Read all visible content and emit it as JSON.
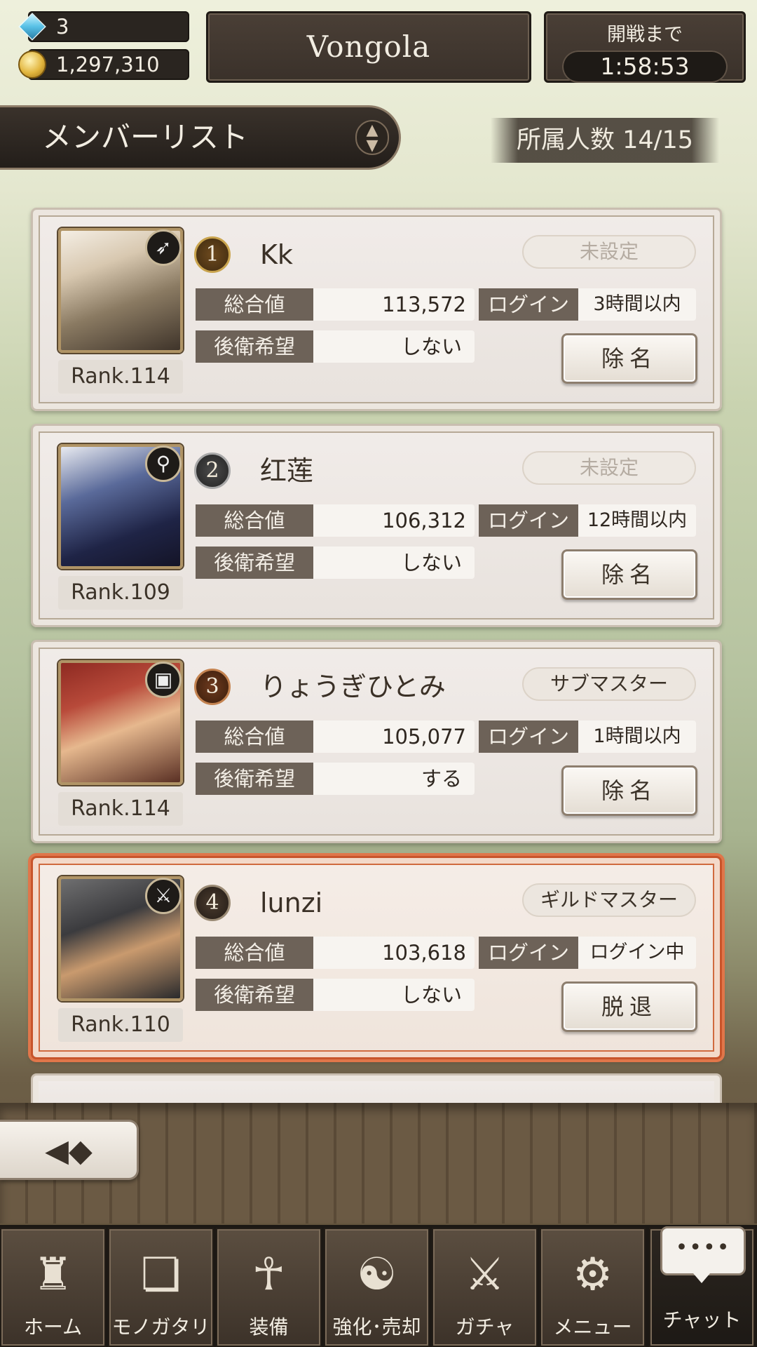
{
  "currency": {
    "gems": "3",
    "coins": "1,297,310"
  },
  "guild": {
    "name": "Vongola"
  },
  "battle_timer": {
    "label": "開戦まで",
    "value": "1:58:53"
  },
  "section": {
    "title": "メンバーリスト",
    "member_count": "所属人数 14/15"
  },
  "stat_labels": {
    "total": "総合値",
    "login": "ログイン",
    "rear_guard": "後衛希望"
  },
  "members": [
    {
      "position": "1",
      "name": "Kk",
      "rank": "Rank.114",
      "role": "未設定",
      "total": "113,572",
      "login": "3時間以内",
      "rear_guard": "しない",
      "action": "除名",
      "class_icon": "bow-icon"
    },
    {
      "position": "2",
      "name": "红莲",
      "rank": "Rank.109",
      "role": "未設定",
      "total": "106,312",
      "login": "12時間以内",
      "rear_guard": "しない",
      "action": "除名",
      "class_icon": "staff-icon"
    },
    {
      "position": "3",
      "name": "りょうぎひとみ",
      "rank": "Rank.114",
      "role": "サブマスター",
      "total": "105,077",
      "login": "1時間以内",
      "rear_guard": "する",
      "action": "除名",
      "class_icon": "tome-icon"
    },
    {
      "position": "4",
      "name": "lunzi",
      "rank": "Rank.110",
      "role": "ギルドマスター",
      "total": "103,618",
      "login": "ログイン中",
      "rear_guard": "しない",
      "action": "脱退",
      "class_icon": "sword-icon"
    }
  ],
  "nav": {
    "home": "ホーム",
    "story": "モノガタリ",
    "equip": "装備",
    "enhance": "強化･売却",
    "gacha": "ガチャ",
    "menu": "メニュー",
    "chat": "チャット",
    "chat_bubble": "••••"
  }
}
